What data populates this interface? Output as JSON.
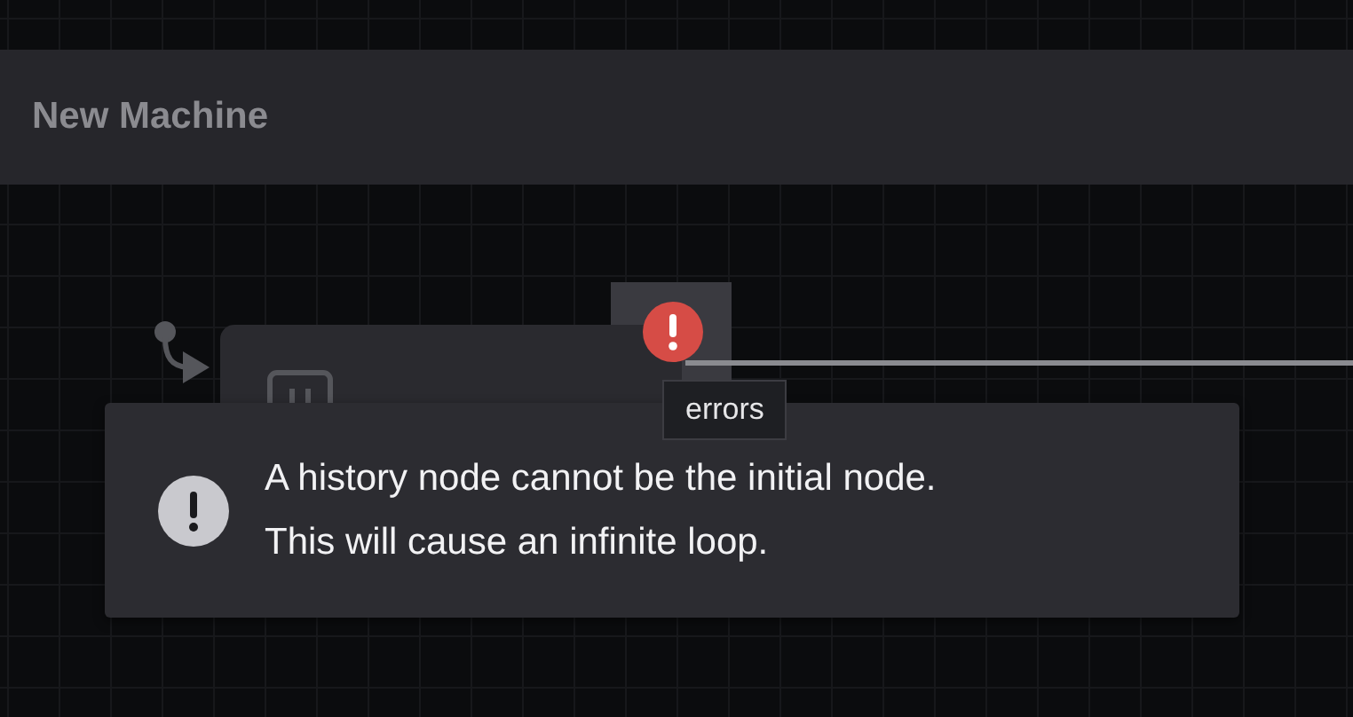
{
  "header": {
    "title": "New Machine"
  },
  "node": {
    "has_error": true,
    "initial": true
  },
  "tooltip": {
    "text": "errors"
  },
  "toast": {
    "kind": "error",
    "lines": [
      "A history node cannot be the initial node.",
      "This will cause an infinite loop."
    ]
  }
}
